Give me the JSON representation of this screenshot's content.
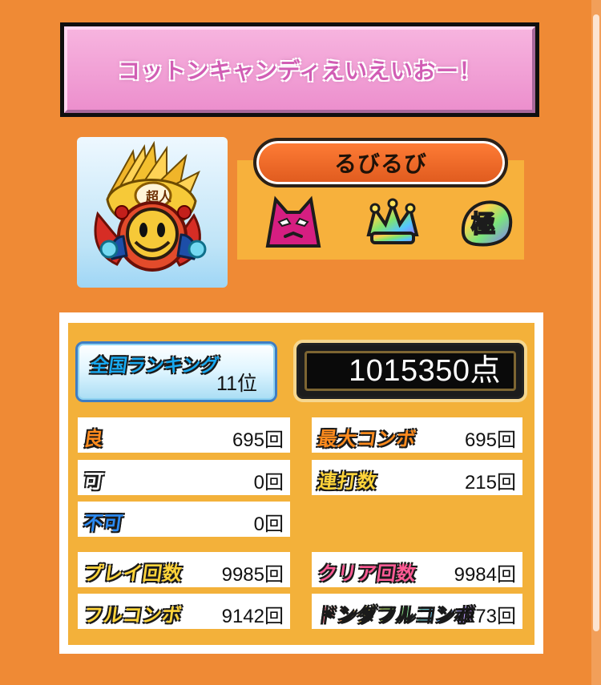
{
  "song": {
    "title": "コットンキャンディえいえいおー！"
  },
  "player": {
    "name": "るびるび",
    "avatar_icon": "armored-daruma-warrior-icon",
    "avatar_badge_text": "超人",
    "badges": [
      {
        "name": "oni-difficulty-icon"
      },
      {
        "name": "rainbow-crown-icon"
      },
      {
        "name": "kiwami-rank-icon",
        "text": "極"
      }
    ]
  },
  "ranking": {
    "label": "全国ランキング",
    "value": "11位"
  },
  "score": {
    "value": "1015350点"
  },
  "stats": {
    "ryo": {
      "label": "良",
      "value": "695回"
    },
    "ka": {
      "label": "可",
      "value": "0回"
    },
    "fuka": {
      "label": "不可",
      "value": "0回"
    },
    "max_combo": {
      "label": "最大コンボ",
      "value": "695回"
    },
    "drumroll": {
      "label": "連打数",
      "value": "215回"
    },
    "play_count": {
      "label": "プレイ回数",
      "value": "9985回"
    },
    "full_combo": {
      "label": "フルコンボ",
      "value": "9142回"
    },
    "clear_count": {
      "label": "クリア回数",
      "value": "9984回"
    },
    "donda_full_combo": {
      "label": "ドンダフルコンボ",
      "value": "7273回"
    }
  },
  "colors": {
    "background": "#ef8a35",
    "panel": "#f3b13a",
    "title_pink": "#ec8fcd",
    "score_black": "#0a0a0a",
    "ranking_blue": "#18a9f0"
  }
}
